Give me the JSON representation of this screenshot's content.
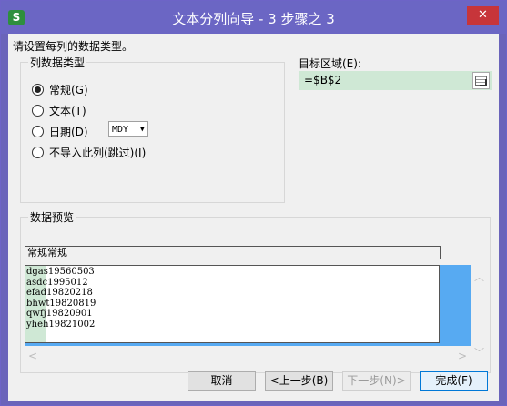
{
  "window": {
    "title": "文本分列向导 - 3 步骤之 3",
    "app_icon": "S",
    "close_symbol": "✕"
  },
  "instruction": "请设置每列的数据类型。",
  "column_type": {
    "legend": "列数据类型",
    "options": [
      {
        "label": "常规(G)",
        "checked": true
      },
      {
        "label": "文本(T)",
        "checked": false
      },
      {
        "label": "日期(D)",
        "checked": false
      },
      {
        "label": "不导入此列(跳过)(I)",
        "checked": false
      }
    ],
    "date_format": "MDY"
  },
  "target": {
    "label": "目标区域(E):",
    "value": "=$B$2"
  },
  "preview": {
    "legend": "数据预览",
    "header": "常规常规",
    "rows": [
      "dgas19560503",
      "asdc1995012",
      "efad19820218",
      "bhwt19820819",
      "qwfj19820901",
      "yheh19821002"
    ]
  },
  "buttons": {
    "cancel": "取消",
    "back": "<上一步(B)",
    "next": "下一步(N)>",
    "finish": "完成(F)"
  },
  "scroll": {
    "up": "︿",
    "down": "﹀",
    "left": "<",
    "right": ">"
  },
  "colors": {
    "titlebar": "#6b66c4",
    "close": "#c7353a",
    "selection": "#57aaf2",
    "column_highlight": "#cfe8d5"
  }
}
